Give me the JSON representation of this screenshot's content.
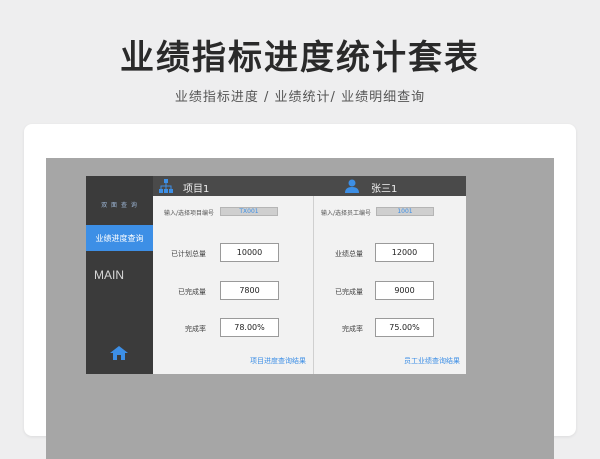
{
  "hero": {
    "title": "业绩指标进度统计套表",
    "subtitle": "业绩指标进度  /  业绩统计/  业绩明细查询"
  },
  "sidebar": {
    "top_label": "双 面 查 询",
    "active_item": "业绩进度查询",
    "main_label": "MAIN"
  },
  "left_panel": {
    "header": "项目1",
    "id_label": "输入/选择项目编号",
    "id_value": "TX001",
    "fields": [
      {
        "label": "已计划总量",
        "value": "10000"
      },
      {
        "label": "已完成量",
        "value": "7800"
      },
      {
        "label": "完成率",
        "value": "78.00%"
      }
    ],
    "result_link": "项目进度查询结果"
  },
  "right_panel": {
    "header": "张三1",
    "id_label": "输入/选择员工编号",
    "id_value": "1001",
    "fields": [
      {
        "label": "业绩总量",
        "value": "12000"
      },
      {
        "label": "已完成量",
        "value": "9000"
      },
      {
        "label": "完成率",
        "value": "75.00%"
      }
    ],
    "result_link": "员工业绩查询结果"
  },
  "colors": {
    "accent": "#3d8fe6",
    "sidebar": "#3b3b3b",
    "header": "#4a4a4a"
  },
  "icons": {
    "left_header": "hierarchy-icon",
    "right_header": "user-icon",
    "sidebar_bottom": "home-icon"
  }
}
